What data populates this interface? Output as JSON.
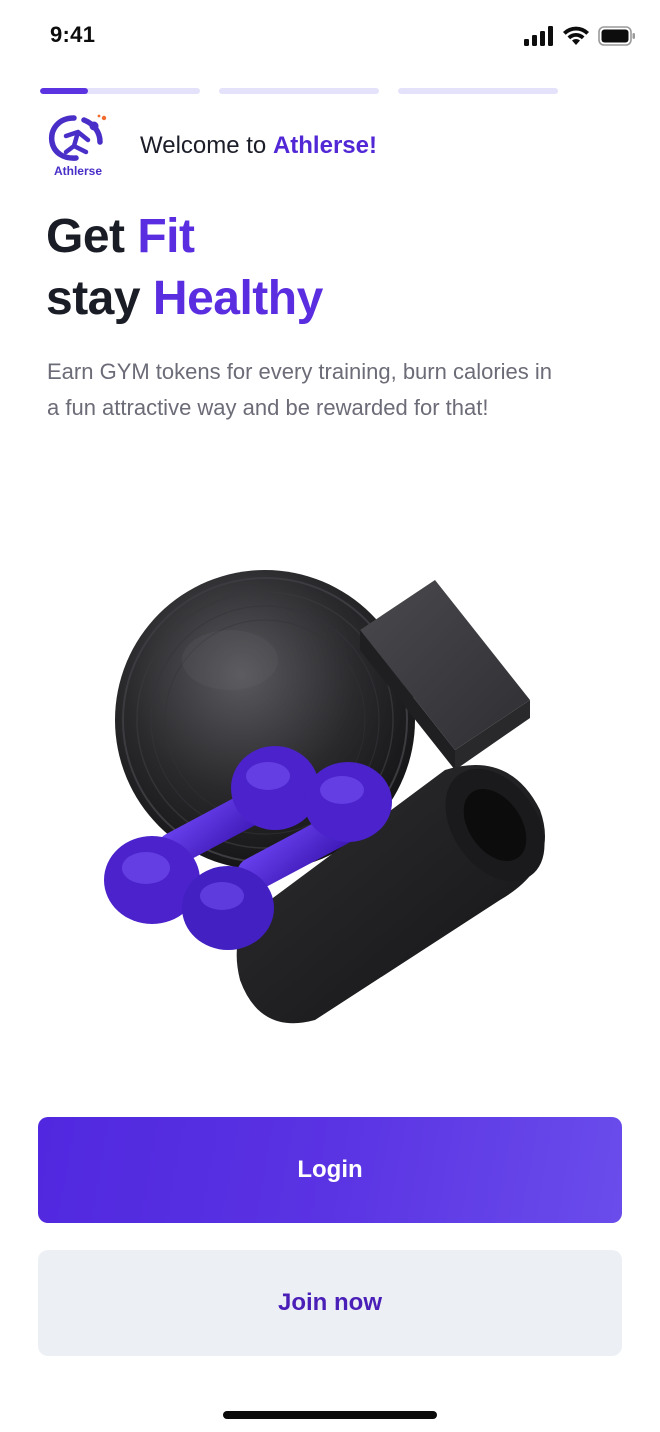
{
  "status_bar": {
    "time": "9:41",
    "icons": [
      "cellular-signal-icon",
      "wifi-icon",
      "battery-icon"
    ]
  },
  "onboarding": {
    "step_count": 3,
    "current_step": 1,
    "current_step_progress": 0.3
  },
  "brand": {
    "logo_text": "Athlerse",
    "welcome_prefix": "Welcome to ",
    "welcome_brand": "Athlerse!"
  },
  "headline": {
    "line1_plain": "Get ",
    "line1_accent": "Fit",
    "line2_plain": "stay ",
    "line2_accent": "Healthy"
  },
  "subtitle": "Earn GYM tokens for every training, burn calories in a fun attractive way and be rewarded for that!",
  "illustration": {
    "icon": "gym-equipment-illustration"
  },
  "actions": {
    "login_label": "Login",
    "join_label": "Join now"
  },
  "colors": {
    "accent": "#5a2de0",
    "dark_text": "#1a1c26",
    "muted_text": "#6b6c77",
    "secondary_button_bg": "#eceff4",
    "progress_track": "#e4e2fa"
  }
}
